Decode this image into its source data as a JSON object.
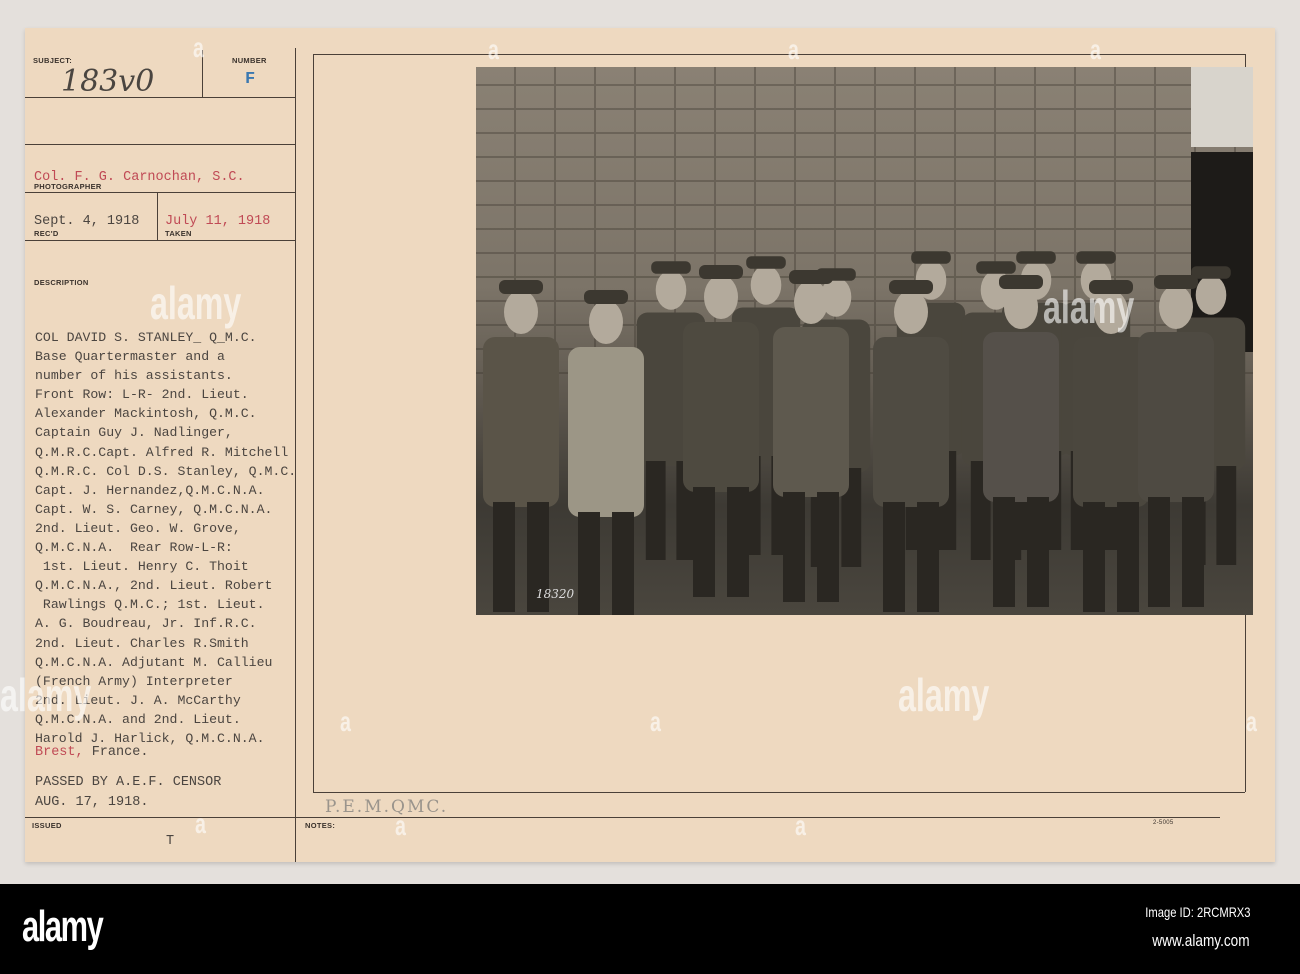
{
  "card": {
    "subject_label": "SUBJECT:",
    "subject_value": "183v0",
    "number_label": "NUMBER",
    "number_value": "F",
    "photographer_label": "PHOTOGRAPHER",
    "photographer_value": "Col. F. G. Carnochan, S.C.",
    "recd_label": "REC'D",
    "recd_value": "Sept. 4, 1918",
    "taken_label": "TAKEN",
    "taken_value": "July 11, 1918",
    "description_label": "DESCRIPTION",
    "description_lines": [
      "COL DAVID S. STANLEY_ Q_M.C.",
      "Base Quartermaster and a",
      "number of his assistants.",
      "Front Row: L-R- 2nd. Lieut.",
      "Alexander Mackintosh, Q.M.C.",
      "Captain Guy J. Nadlinger,",
      "Q.M.R.C.Capt. Alfred R. Mitchell",
      "Q.M.R.C. Col D.S. Stanley, Q.M.C.",
      "Capt. J. Hernandez,Q.M.C.N.A.",
      "Capt. W. S. Carney, Q.M.C.N.A.",
      "2nd. Lieut. Geo. W. Grove,",
      "Q.M.C.N.A.  Rear Row-L-R:",
      " 1st. Lieut. Henry C. Thoit",
      "Q.M.C.N.A., 2nd. Lieut. Robert",
      " Rawlings Q.M.C.; 1st. Lieut.",
      "A. G. Boudreau, Jr. Inf.R.C.",
      "2nd. Lieut. Charles R.Smith",
      "Q.M.C.N.A. Adjutant M. Callieu",
      "(French Army) Interpreter",
      "2nd. Lieut. J. A. McCarthy",
      "Q.M.C.N.A. and 2nd. Lieut.",
      "Harold J. Harlick, Q.M.C.N.A."
    ],
    "location_red": "Brest,",
    "location_rest": " France.",
    "censor_line1": "PASSED BY A.E.F. CENSOR",
    "censor_line2": "AUG. 17, 1918.",
    "issued_label": "ISSUED",
    "issued_value": "T",
    "notes_label": "NOTES:",
    "notes_handwritten": "P.E.M.QMC.",
    "form_number": "2-5005",
    "photo_number": "18320"
  },
  "watermark": {
    "logo": "alamy",
    "mark": "a"
  },
  "footer": {
    "logo": "alamy",
    "image_id": "Image ID: 2RCMRX3",
    "url": "www.alamy.com"
  },
  "colors": {
    "card": "#eed9c0",
    "red_type": "#c04a55",
    "number_blue": "#3a78b0"
  }
}
